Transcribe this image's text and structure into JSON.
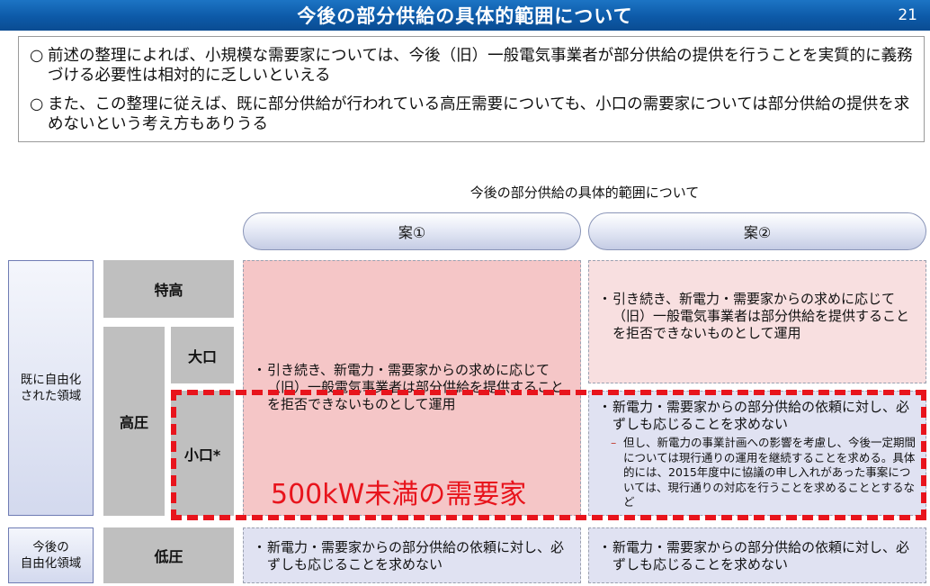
{
  "header": {
    "title": "今後の部分供給の具体的範囲について",
    "page_number": "21"
  },
  "summary": {
    "items": [
      {
        "bullet": "○",
        "text": "前述の整理によれば、小規模な需要家については、今後（旧）一般電気事業者が部分供給の提供を行うことを実質的に義務づける必要性は相対的に乏しいといえる"
      },
      {
        "bullet": "○",
        "text": "また、この整理に従えば、既に部分供給が行われている高圧需要についても、小口の需要家については部分供給の提供を求めないという考え方もありうる"
      }
    ]
  },
  "table": {
    "heading": "今後の部分供給の具体的範囲について",
    "plans": [
      "案①",
      "案②"
    ],
    "regions": {
      "liberalized": "既に自由化\nされた領域",
      "future": "今後の\n自由化領域"
    },
    "categories": {
      "tokkou": "特高",
      "kouatsu": "高圧",
      "ooguchi": "大口",
      "koguchi": "小口*",
      "teiatsu": "低圧"
    },
    "cells": {
      "plan1_upper": "引き続き、新電力・需要家からの求めに応じて（旧）一般電気事業者は部分供給を提供することを拒否できないものとして運用",
      "plan2_upper": "引き続き、新電力・需要家からの求めに応じて（旧）一般電気事業者は部分供給を提供することを拒否できないものとして運用",
      "plan2_koguchi": "新電力・需要家からの部分供給の依頼に対し、必ずしも応じることを求めない",
      "plan2_koguchi_sub": "但し、新電力の事業計画への影響を考慮し、今後一定期間については現行通りの運用を継続することを求める。具体的には、2015年度中に協議の申し入れがあった事案については、現行通りの対応を行うことを求めることとするなど",
      "plan1_teiatsu": "新電力・需要家からの部分供給の依頼に対し、必ずしも応じることを求めない",
      "plan2_teiatsu": "新電力・需要家からの部分供給の依頼に対し、必ずしも応じることを求めない"
    },
    "bullet": "・",
    "sub_bullet": "–",
    "highlight_label": "500kW未満の需要家"
  },
  "colors": {
    "title_bar": "#0d5aa8",
    "highlight": "#e8141c",
    "pink_cell": "#f5c6c7",
    "lavender_cell": "#e0e2f2"
  }
}
